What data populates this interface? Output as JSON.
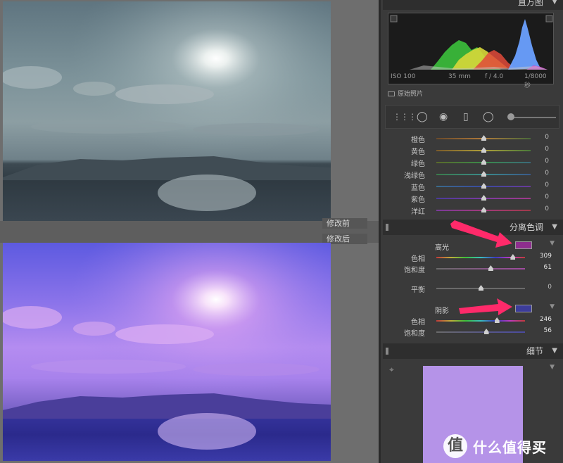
{
  "left": {
    "before_label": "修改前",
    "after_label": "修改后"
  },
  "panel": {
    "histogram_title": "直方图",
    "exif": {
      "iso": "ISO 100",
      "focal": "35 mm",
      "aperture": "f / 4.0",
      "shutter": "1/8000 秒"
    },
    "original_photo_label": "原始照片",
    "hsl": [
      {
        "label": "橙色",
        "value": "0",
        "pos": 0.5,
        "gradient": [
          "#6a4a2a",
          "#b07a3a",
          "#4a6a3a"
        ]
      },
      {
        "label": "黄色",
        "value": "0",
        "pos": 0.5,
        "gradient": [
          "#7a5a2a",
          "#b0a03a",
          "#4a7a3a"
        ]
      },
      {
        "label": "绿色",
        "value": "0",
        "pos": 0.5,
        "gradient": [
          "#5a6a2a",
          "#3a8a4a",
          "#3a6a7a"
        ]
      },
      {
        "label": "浅绿色",
        "value": "0",
        "pos": 0.5,
        "gradient": [
          "#3a7a4a",
          "#3a8a8a",
          "#3a5a8a"
        ]
      },
      {
        "label": "蓝色",
        "value": "0",
        "pos": 0.5,
        "gradient": [
          "#3a6a8a",
          "#3a4aa0",
          "#6a3a9a"
        ]
      },
      {
        "label": "紫色",
        "value": "0",
        "pos": 0.5,
        "gradient": [
          "#4a3a9a",
          "#7a3aa0",
          "#a03a8a"
        ]
      },
      {
        "label": "洋红",
        "value": "0",
        "pos": 0.5,
        "gradient": [
          "#7a3a9a",
          "#a03a7a",
          "#a03a4a"
        ]
      }
    ],
    "split_toning": {
      "title": "分离色调",
      "highlights": {
        "label": "高光",
        "swatch": "#8e2e8e",
        "hue_label": "色相",
        "hue_value": "309",
        "hue_pos": 0.86,
        "sat_label": "饱和度",
        "sat_value": "61",
        "sat_pos": 0.61
      },
      "balance": {
        "label": "平衡",
        "value": "0",
        "pos": 0.5
      },
      "shadows": {
        "label": "阴影",
        "swatch": "#3c3c9a",
        "hue_label": "色相",
        "hue_value": "246",
        "hue_pos": 0.68,
        "sat_label": "饱和度",
        "sat_value": "56",
        "sat_pos": 0.56
      }
    },
    "detail_title": "细节"
  },
  "watermark": {
    "glyph": "值",
    "text": "什么值得买"
  },
  "colors": {
    "arrow": "#ff2a6a",
    "panel_bg": "#3a3a3a",
    "header_bg": "#2e2e2e"
  }
}
